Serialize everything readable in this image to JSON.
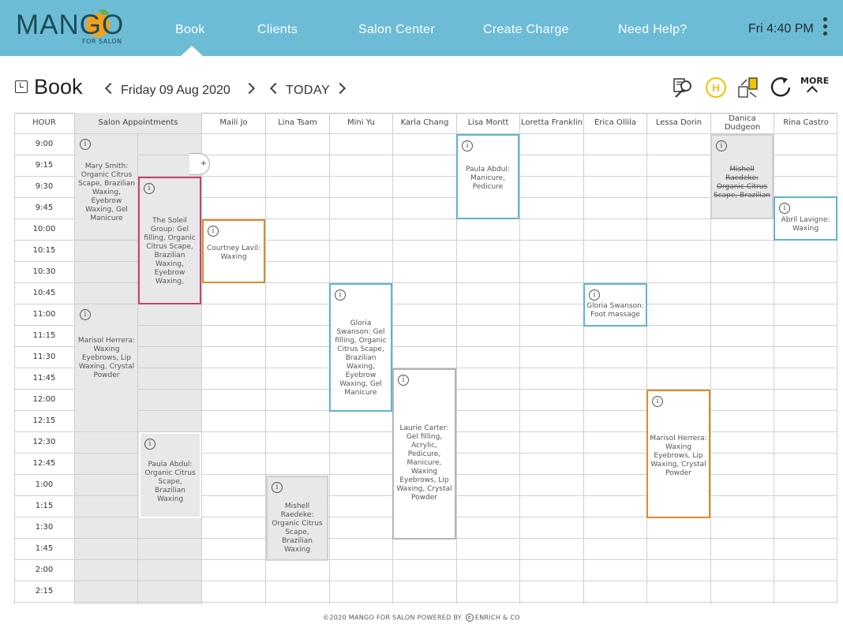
{
  "logo": {
    "word": "MANGO",
    "sub": "FOR SALON"
  },
  "nav": {
    "items": [
      "Book",
      "Clients",
      "Salon Center",
      "Create Charge",
      "Need Help?"
    ],
    "active": "Book",
    "clock": "Fri 4:40 PM"
  },
  "toolbar": {
    "title": "Book",
    "date": "Friday 09 Aug 2020",
    "today": "TODAY",
    "more": "MORE",
    "tool_icons": [
      "search-client-icon",
      "hold-icon",
      "checkin-icon",
      "refresh-icon"
    ],
    "hold_letter": "H"
  },
  "grid": {
    "hour_header": "HOUR",
    "columns": [
      "Salon Appointments",
      "Maili Jo",
      "Lina Tsam",
      "Mini Yu",
      "Karla Chang",
      "Lisa Montt",
      "Loretta Franklin",
      "Erica Ollila",
      "Lessa Dorin",
      "Danica Dudgeon",
      "Rina Castro"
    ],
    "hours": [
      "9:00",
      "9:15",
      "9:30",
      "9:45",
      "10:00",
      "10:15",
      "10:30",
      "10:45",
      "11:00",
      "11:15",
      "11:30",
      "11:45",
      "12:00",
      "12:15",
      "12:30",
      "12:45",
      "1:00",
      "1:15",
      "1:30",
      "1:45",
      "2:00",
      "2:15"
    ],
    "plus": "+"
  },
  "appointments": [
    {
      "text": "Mary Smith: Organic Citrus Scape, Brazilian Waxing, Eyebrow Waxing, Gel Manicure",
      "border": "",
      "fill": "grey"
    },
    {
      "text": "The Soleil Group: Gel filling, Organic Citrus Scape, Brazilian Waxing, Eyebrow Waxing,",
      "border": "#c8436e",
      "fill": "grey"
    },
    {
      "text": "Marisol Herrera: Waxing Eyebrows, Lip Waxing, Crystal Powder",
      "border": "",
      "fill": "grey"
    },
    {
      "text": "Paula Abdul: Organic Citrus Scape, Brazilian Waxing",
      "border": "#ffffff",
      "fill": "grey"
    },
    {
      "text": "Courtney Lavil: Waxing",
      "border": "#e08a2c",
      "fill": "white"
    },
    {
      "text": "Mishell Raedeke: Organic Citrus Scape, Brazilian Waxing",
      "border": "#cfcfcf",
      "fill": "grey"
    },
    {
      "text": "Gloria Swanson: Gel filling, Organic Citrus Scape, Brazilian Waxing, Eyebrow Waxing, Gel Manicure",
      "border": "#5fb4cc",
      "fill": "white"
    },
    {
      "text": "Laurie Carter: Gel filling, Acrylic, Pedicure, Manicure, Waxing Eyebrows, Lip Waxing, Crystal Powder",
      "border": "#b5b5b5",
      "fill": "white"
    },
    {
      "text": "Paula Abdul: Manicure, Pedicure",
      "border": "#5fb4cc",
      "fill": "white"
    },
    {
      "text": "Gloria Swanson: Foot massage",
      "border": "#5fb4cc",
      "fill": "white"
    },
    {
      "text": "Marisol Herrera: Waxing Eyebrows, Lip Waxing, Crystal Powder",
      "border": "#e08a2c",
      "fill": "white"
    },
    {
      "text": "Mishell Raedeke: Organic Citrus Scape, Brazilian",
      "border": "#cfcfcf",
      "fill": "grey",
      "strike": true
    },
    {
      "text": "Abril Lavigne: Waxing",
      "border": "#5fb4cc",
      "fill": "white"
    }
  ],
  "footer": {
    "left": "©2020 MANGO FOR SALON POWERED BY",
    "mark": "e",
    "right": "ENRICH & CO"
  },
  "colors": {
    "nav": "#6cbcd6",
    "pink": "#c8436e",
    "orange": "#e08a2c",
    "blue": "#5fb4cc",
    "grey": "#b5b5b5"
  }
}
